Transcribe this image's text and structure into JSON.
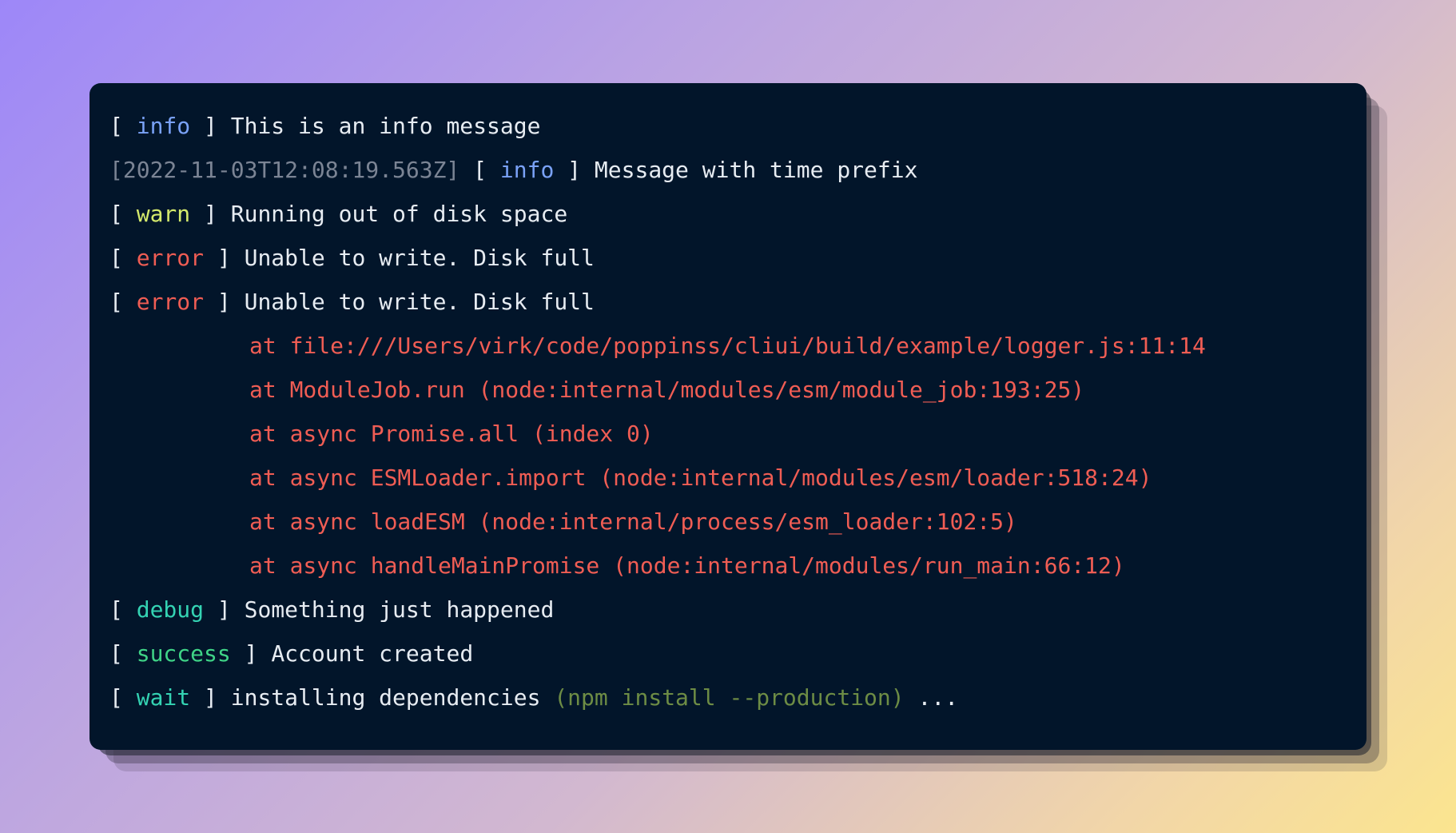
{
  "colors": {
    "terminal_bg": "#02152a",
    "text": "#e7ecf2",
    "info": "#7aa2f7",
    "warn": "#d5ea6c",
    "error": "#f05d54",
    "debug": "#34d3b3",
    "success": "#3fd487",
    "wait": "#34d3b3",
    "timestamp": "#7b8494",
    "command": "#6d8c45"
  },
  "log": {
    "lines": [
      {
        "level": "info",
        "message": "This is an info message"
      },
      {
        "timestamp": "[2022-11-03T12:08:19.563Z]",
        "level": "info",
        "message": "Message with time prefix"
      },
      {
        "level": "warn",
        "message": "Running out of disk space"
      },
      {
        "level": "error",
        "message": "Unable to write. Disk full"
      },
      {
        "level": "error",
        "message": "Unable to write. Disk full"
      }
    ],
    "stack_trace": [
      "at file:///Users/virk/code/poppinss/cliui/build/example/logger.js:11:14",
      "at ModuleJob.run (node:internal/modules/esm/module_job:193:25)",
      "at async Promise.all (index 0)",
      "at async ESMLoader.import (node:internal/modules/esm/loader:518:24)",
      "at async loadESM (node:internal/process/esm_loader:102:5)",
      "at async handleMainPromise (node:internal/modules/run_main:66:12)"
    ],
    "after": [
      {
        "level": "debug",
        "message": "Something just happened"
      },
      {
        "level": "success",
        "message": "Account created"
      },
      {
        "level": "wait",
        "message": "installing dependencies",
        "command": "(npm install --production)",
        "ellipsis": "..."
      }
    ]
  }
}
